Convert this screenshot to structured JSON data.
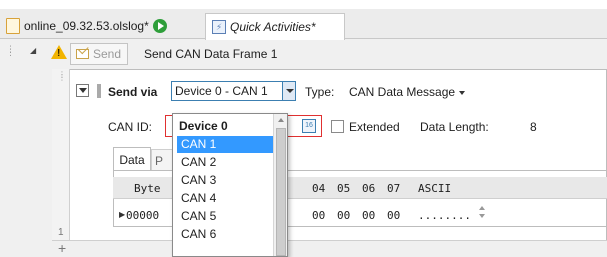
{
  "tabs": [
    {
      "label": "online_09.32.53.olslog*"
    },
    {
      "label": "Quick Activities*"
    }
  ],
  "send_row": {
    "button_label": "Send",
    "title": "Send CAN Data Frame 1"
  },
  "config": {
    "send_via_label": "Send via",
    "device_value": "Device 0  -  CAN 1",
    "type_label": "Type:",
    "type_value": "CAN Data Message",
    "can_id_label": "CAN ID:",
    "hex_icon_text": "16",
    "extended_label": "Extended",
    "data_length_label": "Data Length:",
    "data_length_value": "8"
  },
  "data_tabs": [
    "Data",
    "P"
  ],
  "grid": {
    "byte_header": "Byte",
    "columns": [
      "04",
      "05",
      "06",
      "07",
      "ASCII"
    ],
    "row": {
      "addr": "00000",
      "values": [
        "00",
        "00",
        "00",
        "00",
        "........"
      ]
    }
  },
  "dropdown": {
    "header": "Device 0",
    "items": [
      "CAN 1",
      "CAN 2",
      "CAN 3",
      "CAN 4",
      "CAN 5",
      "CAN 6"
    ],
    "selected_index": 0
  },
  "side_row_number": "1",
  "colors": {
    "selection": "#3399ff",
    "error_border": "#e03030",
    "focus_border": "#3c7fb1",
    "warning": "#f2b400"
  }
}
